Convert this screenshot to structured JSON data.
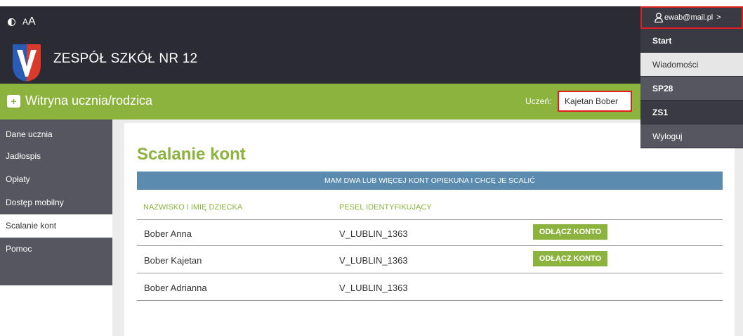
{
  "header": {
    "contrast_label": "",
    "font_small": "A",
    "font_large": "A",
    "school_name": "ZESPÓŁ SZKÓŁ NR 12"
  },
  "portal": {
    "title": "Witryna ucznia/rodzica",
    "student_label": "Uczeń:",
    "student_value": "Kajetan Bober"
  },
  "sidebar": {
    "items": [
      {
        "label": "Dane ucznia"
      },
      {
        "label": "Jadłospis"
      },
      {
        "label": "Opłaty"
      },
      {
        "label": "Dostęp mobilny"
      },
      {
        "label": "Scalanie kont"
      },
      {
        "label": "Pomoc"
      }
    ]
  },
  "main": {
    "title": "Scalanie kont",
    "banner": "MAM DWA LUB WIĘCEJ KONT OPIEKUNA I CHCĘ JE SCALIĆ",
    "columns": [
      "NAZWISKO I IMIĘ DZIECKA",
      "PESEL IDENTYFIKUJĄCY"
    ],
    "rows": [
      {
        "name": "Bober Anna",
        "pesel": "V_LUBLIN_1363",
        "action": "ODŁĄCZ KONTO"
      },
      {
        "name": "Bober Kajetan",
        "pesel": "V_LUBLIN_1363",
        "action": "ODŁĄCZ KONTO"
      },
      {
        "name": "Bober Adrianna",
        "pesel": "V_LUBLIN_1363",
        "action": ""
      }
    ]
  },
  "user_menu": {
    "email": "ewab@mail.pl",
    "chevron": ">",
    "items": [
      "Start",
      "Wiadomości",
      "SP28",
      "ZS1",
      "Wyloguj"
    ]
  },
  "colors": {
    "accent_green": "#8cb33d",
    "header_dark": "#2b2b36",
    "table_blue": "#5c8bb0",
    "highlight_red": "#e02020"
  }
}
